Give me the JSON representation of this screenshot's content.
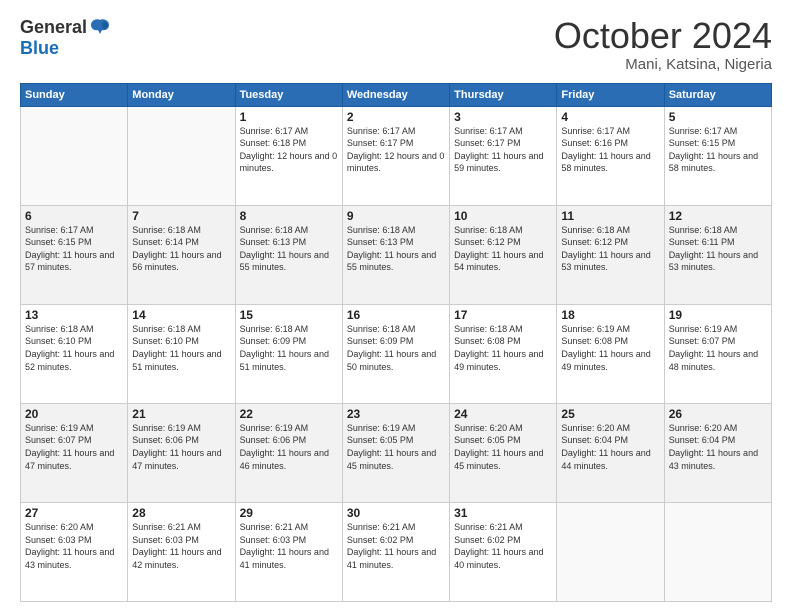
{
  "logo": {
    "general": "General",
    "blue": "Blue"
  },
  "header": {
    "month": "October 2024",
    "location": "Mani, Katsina, Nigeria"
  },
  "weekdays": [
    "Sunday",
    "Monday",
    "Tuesday",
    "Wednesday",
    "Thursday",
    "Friday",
    "Saturday"
  ],
  "weeks": [
    [
      {
        "day": "",
        "info": ""
      },
      {
        "day": "",
        "info": ""
      },
      {
        "day": "1",
        "sunrise": "Sunrise: 6:17 AM",
        "sunset": "Sunset: 6:18 PM",
        "daylight": "Daylight: 12 hours and 0 minutes."
      },
      {
        "day": "2",
        "sunrise": "Sunrise: 6:17 AM",
        "sunset": "Sunset: 6:17 PM",
        "daylight": "Daylight: 12 hours and 0 minutes."
      },
      {
        "day": "3",
        "sunrise": "Sunrise: 6:17 AM",
        "sunset": "Sunset: 6:17 PM",
        "daylight": "Daylight: 11 hours and 59 minutes."
      },
      {
        "day": "4",
        "sunrise": "Sunrise: 6:17 AM",
        "sunset": "Sunset: 6:16 PM",
        "daylight": "Daylight: 11 hours and 58 minutes."
      },
      {
        "day": "5",
        "sunrise": "Sunrise: 6:17 AM",
        "sunset": "Sunset: 6:15 PM",
        "daylight": "Daylight: 11 hours and 58 minutes."
      }
    ],
    [
      {
        "day": "6",
        "sunrise": "Sunrise: 6:17 AM",
        "sunset": "Sunset: 6:15 PM",
        "daylight": "Daylight: 11 hours and 57 minutes."
      },
      {
        "day": "7",
        "sunrise": "Sunrise: 6:18 AM",
        "sunset": "Sunset: 6:14 PM",
        "daylight": "Daylight: 11 hours and 56 minutes."
      },
      {
        "day": "8",
        "sunrise": "Sunrise: 6:18 AM",
        "sunset": "Sunset: 6:13 PM",
        "daylight": "Daylight: 11 hours and 55 minutes."
      },
      {
        "day": "9",
        "sunrise": "Sunrise: 6:18 AM",
        "sunset": "Sunset: 6:13 PM",
        "daylight": "Daylight: 11 hours and 55 minutes."
      },
      {
        "day": "10",
        "sunrise": "Sunrise: 6:18 AM",
        "sunset": "Sunset: 6:12 PM",
        "daylight": "Daylight: 11 hours and 54 minutes."
      },
      {
        "day": "11",
        "sunrise": "Sunrise: 6:18 AM",
        "sunset": "Sunset: 6:12 PM",
        "daylight": "Daylight: 11 hours and 53 minutes."
      },
      {
        "day": "12",
        "sunrise": "Sunrise: 6:18 AM",
        "sunset": "Sunset: 6:11 PM",
        "daylight": "Daylight: 11 hours and 53 minutes."
      }
    ],
    [
      {
        "day": "13",
        "sunrise": "Sunrise: 6:18 AM",
        "sunset": "Sunset: 6:10 PM",
        "daylight": "Daylight: 11 hours and 52 minutes."
      },
      {
        "day": "14",
        "sunrise": "Sunrise: 6:18 AM",
        "sunset": "Sunset: 6:10 PM",
        "daylight": "Daylight: 11 hours and 51 minutes."
      },
      {
        "day": "15",
        "sunrise": "Sunrise: 6:18 AM",
        "sunset": "Sunset: 6:09 PM",
        "daylight": "Daylight: 11 hours and 51 minutes."
      },
      {
        "day": "16",
        "sunrise": "Sunrise: 6:18 AM",
        "sunset": "Sunset: 6:09 PM",
        "daylight": "Daylight: 11 hours and 50 minutes."
      },
      {
        "day": "17",
        "sunrise": "Sunrise: 6:18 AM",
        "sunset": "Sunset: 6:08 PM",
        "daylight": "Daylight: 11 hours and 49 minutes."
      },
      {
        "day": "18",
        "sunrise": "Sunrise: 6:19 AM",
        "sunset": "Sunset: 6:08 PM",
        "daylight": "Daylight: 11 hours and 49 minutes."
      },
      {
        "day": "19",
        "sunrise": "Sunrise: 6:19 AM",
        "sunset": "Sunset: 6:07 PM",
        "daylight": "Daylight: 11 hours and 48 minutes."
      }
    ],
    [
      {
        "day": "20",
        "sunrise": "Sunrise: 6:19 AM",
        "sunset": "Sunset: 6:07 PM",
        "daylight": "Daylight: 11 hours and 47 minutes."
      },
      {
        "day": "21",
        "sunrise": "Sunrise: 6:19 AM",
        "sunset": "Sunset: 6:06 PM",
        "daylight": "Daylight: 11 hours and 47 minutes."
      },
      {
        "day": "22",
        "sunrise": "Sunrise: 6:19 AM",
        "sunset": "Sunset: 6:06 PM",
        "daylight": "Daylight: 11 hours and 46 minutes."
      },
      {
        "day": "23",
        "sunrise": "Sunrise: 6:19 AM",
        "sunset": "Sunset: 6:05 PM",
        "daylight": "Daylight: 11 hours and 45 minutes."
      },
      {
        "day": "24",
        "sunrise": "Sunrise: 6:20 AM",
        "sunset": "Sunset: 6:05 PM",
        "daylight": "Daylight: 11 hours and 45 minutes."
      },
      {
        "day": "25",
        "sunrise": "Sunrise: 6:20 AM",
        "sunset": "Sunset: 6:04 PM",
        "daylight": "Daylight: 11 hours and 44 minutes."
      },
      {
        "day": "26",
        "sunrise": "Sunrise: 6:20 AM",
        "sunset": "Sunset: 6:04 PM",
        "daylight": "Daylight: 11 hours and 43 minutes."
      }
    ],
    [
      {
        "day": "27",
        "sunrise": "Sunrise: 6:20 AM",
        "sunset": "Sunset: 6:03 PM",
        "daylight": "Daylight: 11 hours and 43 minutes."
      },
      {
        "day": "28",
        "sunrise": "Sunrise: 6:21 AM",
        "sunset": "Sunset: 6:03 PM",
        "daylight": "Daylight: 11 hours and 42 minutes."
      },
      {
        "day": "29",
        "sunrise": "Sunrise: 6:21 AM",
        "sunset": "Sunset: 6:03 PM",
        "daylight": "Daylight: 11 hours and 41 minutes."
      },
      {
        "day": "30",
        "sunrise": "Sunrise: 6:21 AM",
        "sunset": "Sunset: 6:02 PM",
        "daylight": "Daylight: 11 hours and 41 minutes."
      },
      {
        "day": "31",
        "sunrise": "Sunrise: 6:21 AM",
        "sunset": "Sunset: 6:02 PM",
        "daylight": "Daylight: 11 hours and 40 minutes."
      },
      {
        "day": "",
        "info": ""
      },
      {
        "day": "",
        "info": ""
      }
    ]
  ]
}
